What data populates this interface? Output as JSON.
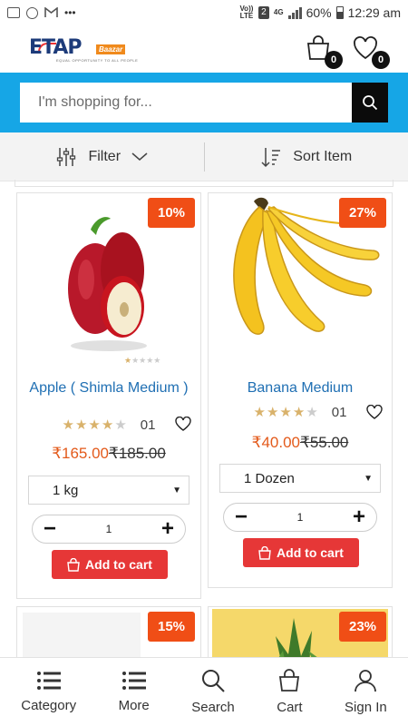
{
  "status_bar": {
    "left_icons": [
      "gallery-icon",
      "whatsapp-icon",
      "gmail-icon",
      "more-dots-icon"
    ],
    "dots": "•••",
    "volte": "Vo)) LTE",
    "sim": "2",
    "network": "4G",
    "battery_pct": "60%",
    "time": "12:29 am"
  },
  "header": {
    "logo_text": "ETAP",
    "logo_badge": "Baazar",
    "logo_tagline": "EQUAL OPPORTUNITY TO ALL PEOPLE",
    "cart_count": "0",
    "wishlist_count": "0"
  },
  "search": {
    "placeholder": "I'm shopping for..."
  },
  "filter_bar": {
    "filter_label": "Filter",
    "sort_label": "Sort Item"
  },
  "products": [
    {
      "name": "Apple ( Shimla Medium )",
      "discount": "10%",
      "rating": 4,
      "qty_sold": "01",
      "price": "₹165.00",
      "old_price": "₹185.00",
      "unit": "1 kg",
      "quantity": "1",
      "add_label": "Add to cart"
    },
    {
      "name": "Banana Medium",
      "discount": "27%",
      "rating": 4,
      "qty_sold": "01",
      "price": "₹40.00",
      "old_price": "₹55.00",
      "unit": "1 Dozen",
      "quantity": "1",
      "add_label": "Add to cart"
    },
    {
      "discount": "15%"
    },
    {
      "discount": "23%"
    }
  ],
  "bottom_nav": {
    "items": [
      {
        "label": "Category",
        "icon": "list-icon"
      },
      {
        "label": "More",
        "icon": "list-icon"
      },
      {
        "label": "Search",
        "icon": "search-icon"
      },
      {
        "label": "Cart",
        "icon": "bag-icon"
      },
      {
        "label": "Sign In",
        "icon": "user-icon"
      }
    ]
  },
  "colors": {
    "search_band": "#16a6e6",
    "discount": "#f04e16",
    "cart_button": "#e63737",
    "price": "#e35a1b",
    "product_name": "#1f6fb3"
  }
}
